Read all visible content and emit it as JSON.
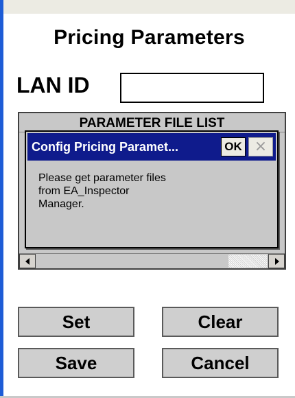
{
  "screen": {
    "title": "Pricing Parameters"
  },
  "lan": {
    "label": "LAN ID",
    "value": ""
  },
  "file_list": {
    "header": "PARAMETER FILE LIST"
  },
  "dialog": {
    "title": "Config Pricing Paramet...",
    "ok_label": "OK",
    "close_label": "×",
    "message_lines": [
      "Please get parameter files",
      "from EA_Inspector",
      "Manager."
    ]
  },
  "buttons": {
    "set": "Set",
    "clear": "Clear",
    "save": "Save",
    "cancel": "Cancel"
  },
  "colors": {
    "titlebar": "#0f1b8c",
    "accent_bar": "#1d5cd6",
    "panel": "#c8c8c8"
  }
}
